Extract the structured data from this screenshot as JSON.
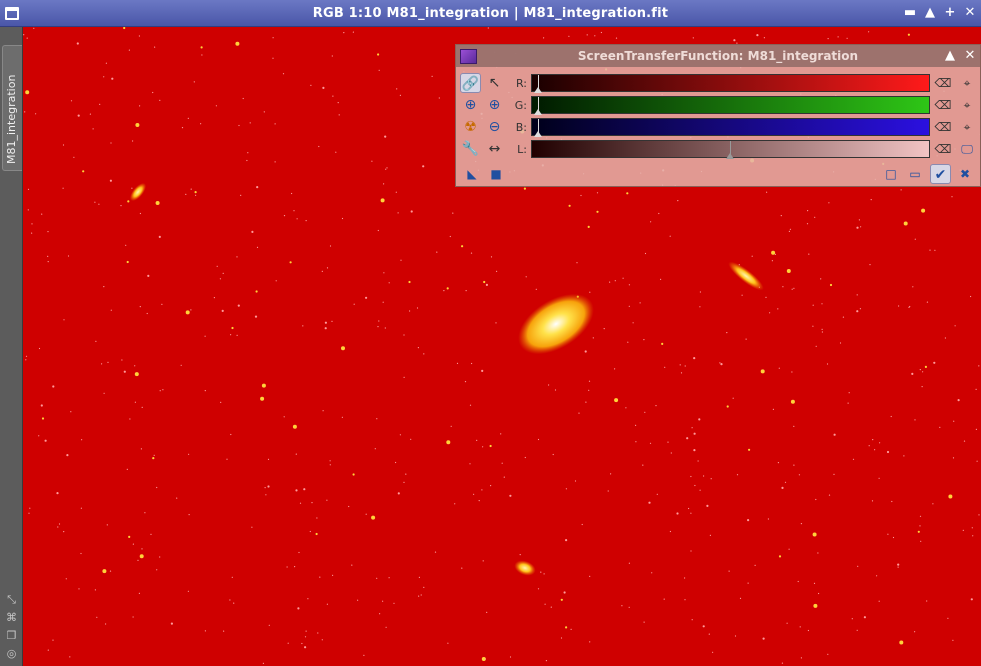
{
  "window": {
    "title": "RGB 1:10 M81_integration | M81_integration.fit",
    "buttons": [
      "▬",
      "▲",
      "+",
      "✕"
    ]
  },
  "sidebar": {
    "tab_label": "M81_integration",
    "icons": [
      "shrink-icon",
      "fit-icon",
      "clone-icon",
      "target-icon"
    ]
  },
  "stf_panel": {
    "title": "ScreenTransferFunction: M81_integration",
    "channels": [
      {
        "label": "R:",
        "color": "#ff1a1a"
      },
      {
        "label": "G:",
        "color": "#2ec616"
      },
      {
        "label": "B:",
        "color": "#2b10e0"
      },
      {
        "label": "L:",
        "color": "#f2c4c4"
      }
    ],
    "left_tools": [
      "link-icon",
      "pointer-icon",
      "zoom-in-icon",
      "zoom-plus-icon",
      "radiation-icon",
      "zoom-minus-icon",
      "wrench-icon",
      "pan-icon"
    ],
    "right_tools": [
      "reset-icon",
      "target-icon",
      "monitor-icon"
    ],
    "bottom_tools": [
      "new-instance-icon",
      "square-stop-icon",
      "square-icon",
      "page-icon",
      "apply-check-icon",
      "collapse-icon"
    ]
  },
  "colors": {
    "background": "#cf0000",
    "titlebar": "#5965b8"
  }
}
